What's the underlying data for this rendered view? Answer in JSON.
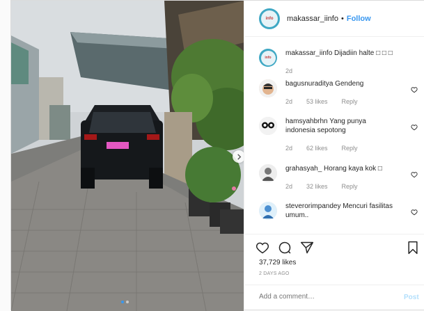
{
  "post": {
    "owner": {
      "username": "makassar_iinfo",
      "separator": "•",
      "follow_label": "Follow",
      "avatar_icon": "makassar-info-logo"
    },
    "caption": {
      "username": "makassar_iinfo",
      "text": "Dijadiin halte □ □ □",
      "time": "2d"
    },
    "comments": [
      {
        "username": "bagusnuraditya",
        "text": "Gendeng",
        "time": "2d",
        "likes": "53 likes",
        "reply": "Reply"
      },
      {
        "username": "hamsyahbrhn",
        "text": "Yang punya indonesia sepotong",
        "time": "2d",
        "likes": "62 likes",
        "reply": "Reply"
      },
      {
        "username": "grahasyah_",
        "text": "Horang kaya kok □",
        "time": "2d",
        "likes": "32 likes",
        "reply": "Reply"
      },
      {
        "username": "steverorimpandey",
        "text": "Mencuri fasilitas umum..",
        "time": "",
        "likes": "",
        "reply": ""
      }
    ],
    "likes_count": "37,729 likes",
    "posted_date": "2 DAYS AGO",
    "add_comment_placeholder": "Add a comment…",
    "post_button": "Post",
    "carousel": {
      "slides": 2,
      "active": 1
    },
    "colors": {
      "accent": "#3897f0",
      "post_disabled": "#b2dffc",
      "meta": "#8e8e8e"
    }
  }
}
